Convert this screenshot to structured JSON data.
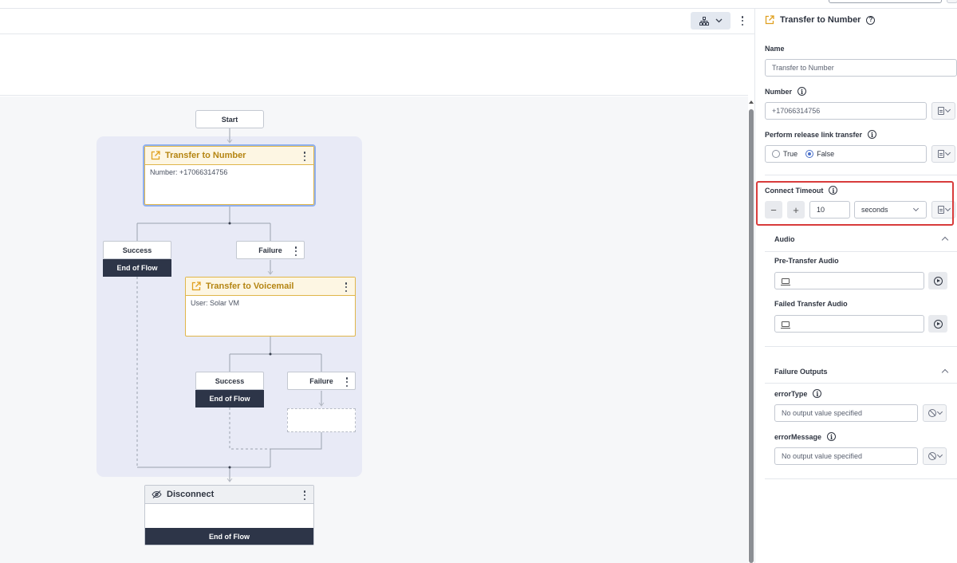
{
  "flow": {
    "start_label": "Start",
    "transfer_to_number": {
      "title": "Transfer to Number",
      "detail": "Number: +17066314756"
    },
    "branch1": {
      "success": "Success",
      "failure": "Failure",
      "end_of_flow": "End of Flow"
    },
    "transfer_to_voicemail": {
      "title": "Transfer to Voicemail",
      "detail": "User: Solar VM"
    },
    "branch2": {
      "success": "Success",
      "failure": "Failure",
      "end_of_flow": "End of Flow"
    },
    "disconnect": {
      "title": "Disconnect",
      "end_of_flow": "End of Flow"
    }
  },
  "panel": {
    "title": "Transfer to Number",
    "name_label": "Name",
    "name_value": "Transfer to Number",
    "number_label": "Number",
    "number_value": "+17066314756",
    "release_label": "Perform release link transfer",
    "radio_true": "True",
    "radio_false": "False",
    "selected_radio": "False",
    "timeout_label": "Connect Timeout",
    "timeout_minus": "−",
    "timeout_plus": "+",
    "timeout_value": "10",
    "timeout_unit": "seconds",
    "audio_section": "Audio",
    "pre_transfer_audio": "Pre-Transfer Audio",
    "failed_transfer_audio": "Failed Transfer Audio",
    "failure_outputs_section": "Failure Outputs",
    "error_type_label": "errorType",
    "error_type_placeholder": "No output value specified",
    "error_message_label": "errorMessage",
    "error_message_placeholder": "No output value specified"
  },
  "colors": {
    "accent_action": "#e0b64a",
    "end_of_flow_bg": "#2d3548",
    "group_bg": "#e8eaf6",
    "highlight": "#d83b3b"
  }
}
